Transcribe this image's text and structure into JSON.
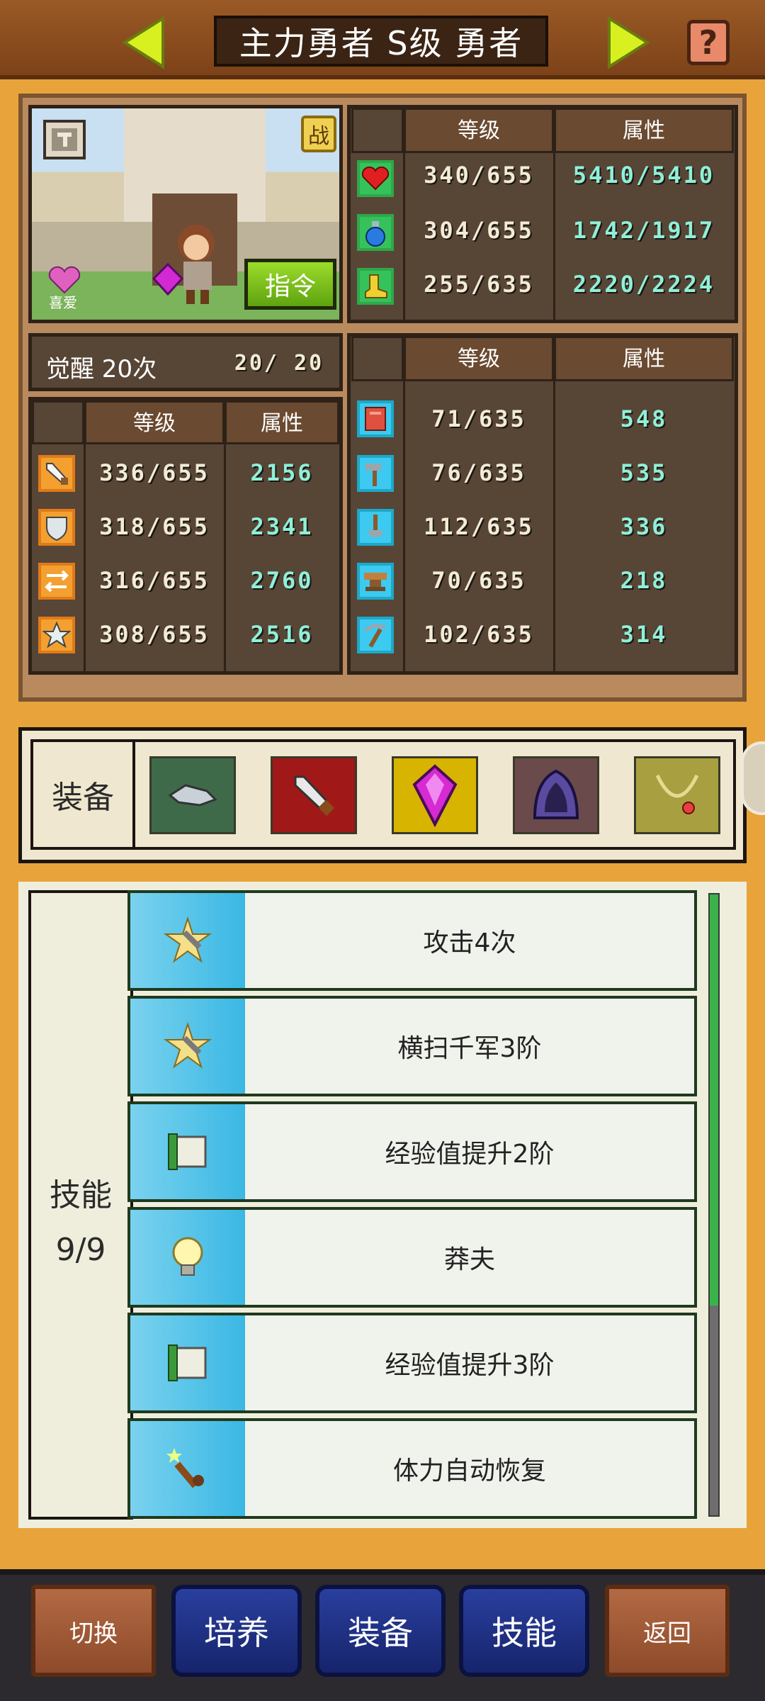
{
  "header": {
    "title": "主力勇者 S级 勇者",
    "prev_icon": "arrow-left-icon",
    "next_icon": "arrow-right-icon",
    "help_label": "?"
  },
  "portrait": {
    "command_label": "指令",
    "like_label": "喜爱",
    "battle_badge": "战"
  },
  "main_stats": {
    "headers": [
      "等级",
      "属性"
    ],
    "rows": [
      {
        "icon": "heart-icon",
        "level": "340/655",
        "value": "5410/5410"
      },
      {
        "icon": "potion-icon",
        "level": "304/655",
        "value": "1742/1917"
      },
      {
        "icon": "boot-icon",
        "level": "255/635",
        "value": "2220/2224"
      }
    ]
  },
  "awaken": {
    "label": "觉醒 20次",
    "count": "20/ 20"
  },
  "combat_stats": {
    "headers": [
      "等级",
      "属性"
    ],
    "rows": [
      {
        "icon": "sword-icon",
        "level": "336/655",
        "value": "2156"
      },
      {
        "icon": "shield-icon",
        "level": "318/655",
        "value": "2341"
      },
      {
        "icon": "cross-arrows-icon",
        "level": "316/655",
        "value": "2760"
      },
      {
        "icon": "star-icon",
        "level": "308/655",
        "value": "2516"
      }
    ]
  },
  "craft_stats": {
    "headers": [
      "等级",
      "属性"
    ],
    "rows": [
      {
        "icon": "book-icon",
        "level": "71/635",
        "value": "548"
      },
      {
        "icon": "hammer-icon",
        "level": "76/635",
        "value": "535"
      },
      {
        "icon": "shovel-icon",
        "level": "112/635",
        "value": "336"
      },
      {
        "icon": "anvil-icon",
        "level": "70/635",
        "value": "218"
      },
      {
        "icon": "pickaxe-icon",
        "level": "102/635",
        "value": "314"
      }
    ]
  },
  "equipment": {
    "label": "装备",
    "slots": [
      {
        "icon": "gauntlet-icon",
        "color": "#3f6a4a"
      },
      {
        "icon": "dagger-icon",
        "color": "#a01818"
      },
      {
        "icon": "purple-gem-icon",
        "color": "#d7b400"
      },
      {
        "icon": "hood-icon",
        "color": "#6a4a4a"
      },
      {
        "icon": "necklace-icon",
        "color": "#a8a040"
      }
    ]
  },
  "skills": {
    "label": "技能",
    "count": "9/9",
    "items": [
      {
        "icon": "slash-icon",
        "name": "攻击4次"
      },
      {
        "icon": "slash-icon",
        "name": "横扫千军3阶"
      },
      {
        "icon": "scroll-icon",
        "name": "经验值提升2阶"
      },
      {
        "icon": "lightbulb-icon",
        "name": "莽夫"
      },
      {
        "icon": "scroll-icon",
        "name": "经验值提升3阶"
      },
      {
        "icon": "wand-icon",
        "name": "体力自动恢复"
      }
    ]
  },
  "nav": {
    "switch": "切换",
    "train": "培养",
    "equip": "装备",
    "skill": "技能",
    "back": "返回"
  }
}
